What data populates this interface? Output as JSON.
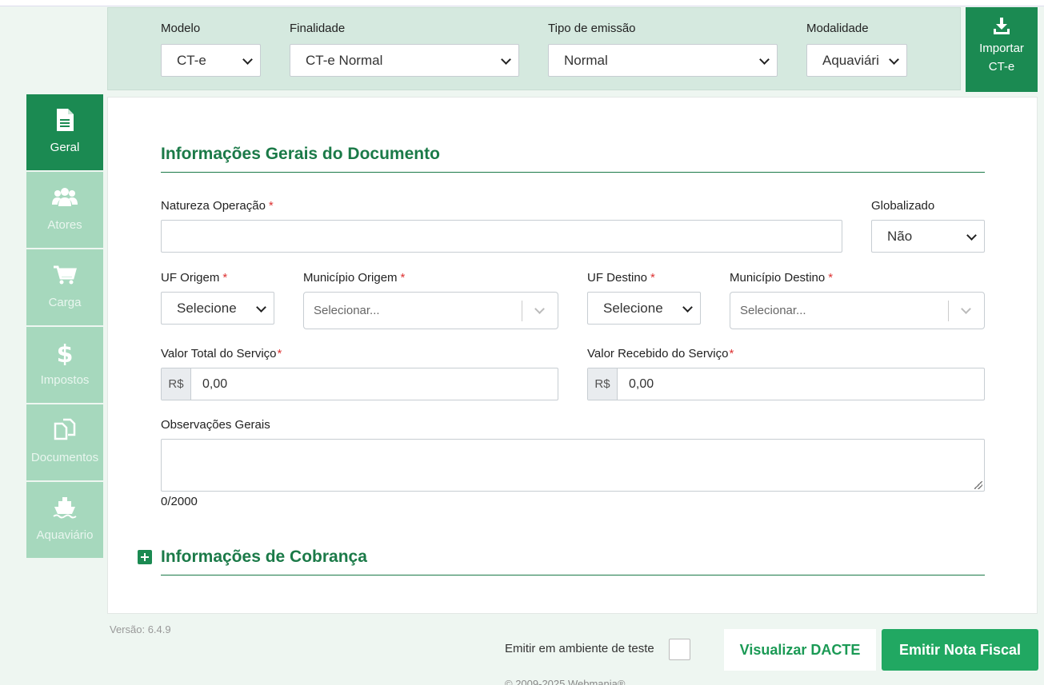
{
  "topbar": {
    "modelo": {
      "label": "Modelo",
      "value": "CT-e"
    },
    "finalidade": {
      "label": "Finalidade",
      "value": "CT-e Normal"
    },
    "tipo_emissao": {
      "label": "Tipo de emissão",
      "value": "Normal"
    },
    "modalidade": {
      "label": "Modalidade",
      "value": "Aquaviári"
    },
    "import_button": {
      "line1": "Importar",
      "line2": "CT-e"
    }
  },
  "sidebar": {
    "items": [
      {
        "label": "Geral",
        "icon": "document-icon",
        "active": true
      },
      {
        "label": "Atores",
        "icon": "users-icon"
      },
      {
        "label": "Carga",
        "icon": "cart-icon"
      },
      {
        "label": "Impostos",
        "icon": "dollar-icon"
      },
      {
        "label": "Documentos",
        "icon": "documents-icon"
      },
      {
        "label": "Aquaviário",
        "icon": "ship-icon"
      }
    ]
  },
  "main": {
    "section_title": "Informações Gerais do Documento",
    "natureza": {
      "label": "Natureza Operação",
      "required": "*",
      "value": ""
    },
    "globalizado": {
      "label": "Globalizado",
      "value": "Não"
    },
    "uf_origem": {
      "label": "UF Origem",
      "required": "*",
      "value": "Selecione"
    },
    "municipio_origem": {
      "label": "Município Origem",
      "required": "*",
      "placeholder": "Selecionar..."
    },
    "uf_destino": {
      "label": "UF Destino",
      "required": "*",
      "value": "Selecione"
    },
    "municipio_destino": {
      "label": "Município Destino",
      "required": "*",
      "placeholder": "Selecionar..."
    },
    "valor_total": {
      "label": "Valor Total do Serviço",
      "required": "*",
      "prefix": "R$",
      "value": "0,00"
    },
    "valor_recebido": {
      "label": "Valor Recebido do Serviço",
      "required": "*",
      "prefix": "R$",
      "value": "0,00"
    },
    "observacoes": {
      "label": "Observações Gerais",
      "counter": "0/2000"
    },
    "cobranca_title": "Informações de Cobrança"
  },
  "footer": {
    "version": "Versão: 6.4.9",
    "test_label": "Emitir em ambiente de teste",
    "visualizar_label": "Visualizar DACTE",
    "emitir_label": "Emitir Nota Fiscal",
    "copyright": "© 2009-2025 Webmania®"
  },
  "colors": {
    "primary": "#1b8a52",
    "accent": "#21a862",
    "nav_inactive": "#a6d8bd",
    "topbar_bg": "#d5e9df"
  }
}
